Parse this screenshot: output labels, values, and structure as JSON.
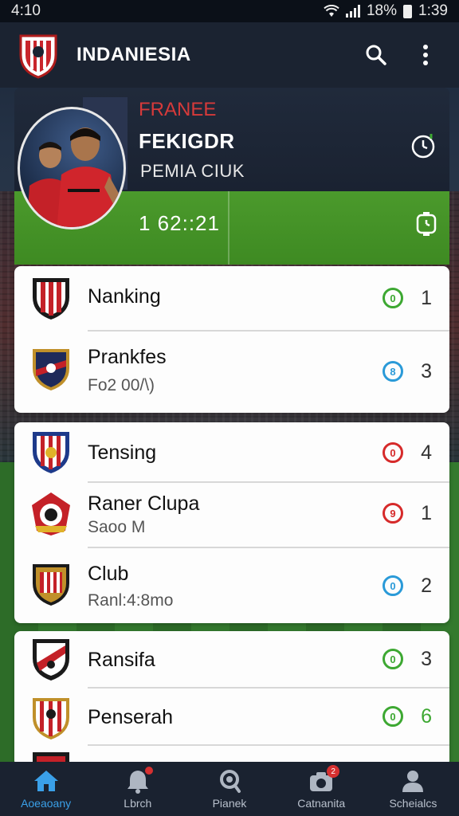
{
  "status_bar": {
    "time_left": "4:10",
    "battery": "18%",
    "time_right": "1:39"
  },
  "app_bar": {
    "title": "INDANIESIA",
    "search_icon": "search-icon",
    "menu_icon": "more-vert-icon"
  },
  "hero": {
    "league": "FRANEE",
    "team": "FEKIGDR",
    "subtitle": "PEMIA CIUK",
    "time": "1 62::21"
  },
  "lists": [
    {
      "rows": [
        {
          "name": "Nanking",
          "detail": "",
          "badge": "0",
          "badge_color": "#3da832",
          "count": "1"
        },
        {
          "name": "Prankfes",
          "detail": "Fo2 00/\\)",
          "badge": "8",
          "badge_color": "#2a9ad8",
          "count": "3"
        }
      ]
    },
    {
      "rows": [
        {
          "name": "Tensing",
          "detail": "",
          "badge": "0",
          "badge_color": "#d62a2a",
          "count": "4"
        },
        {
          "name": "Raner Clupa",
          "detail": "Saoo M",
          "badge": "9",
          "badge_color": "#d62a2a",
          "count": "1"
        },
        {
          "name": "Club",
          "detail": "Ranl:4:8mo",
          "badge": "0",
          "badge_color": "#2a9ad8",
          "count": "2"
        }
      ]
    },
    {
      "rows": [
        {
          "name": "Ransifa",
          "detail": "",
          "badge": "0",
          "badge_color": "#3da832",
          "count": "3"
        },
        {
          "name": "Penserah",
          "detail": "",
          "badge": "0",
          "badge_color": "#3da832",
          "count": "6"
        }
      ]
    }
  ],
  "bottom_nav": [
    {
      "label": "Aoeaoany",
      "icon": "home-icon",
      "active": true,
      "badge": ""
    },
    {
      "label": "Lbrch",
      "icon": "notifications-icon",
      "active": false,
      "badge": ""
    },
    {
      "label": "Pianek",
      "icon": "search-icon",
      "active": false,
      "badge": ""
    },
    {
      "label": "Catnanita",
      "icon": "camera-icon",
      "active": false,
      "badge": "2"
    },
    {
      "label": "Scheialcs",
      "icon": "profile-icon",
      "active": false,
      "badge": ""
    }
  ],
  "colors": {
    "accent": "#3aa0e8",
    "header": "#1b2331",
    "hero_green": "#4b9a2c",
    "league_red": "#d63a3a"
  }
}
